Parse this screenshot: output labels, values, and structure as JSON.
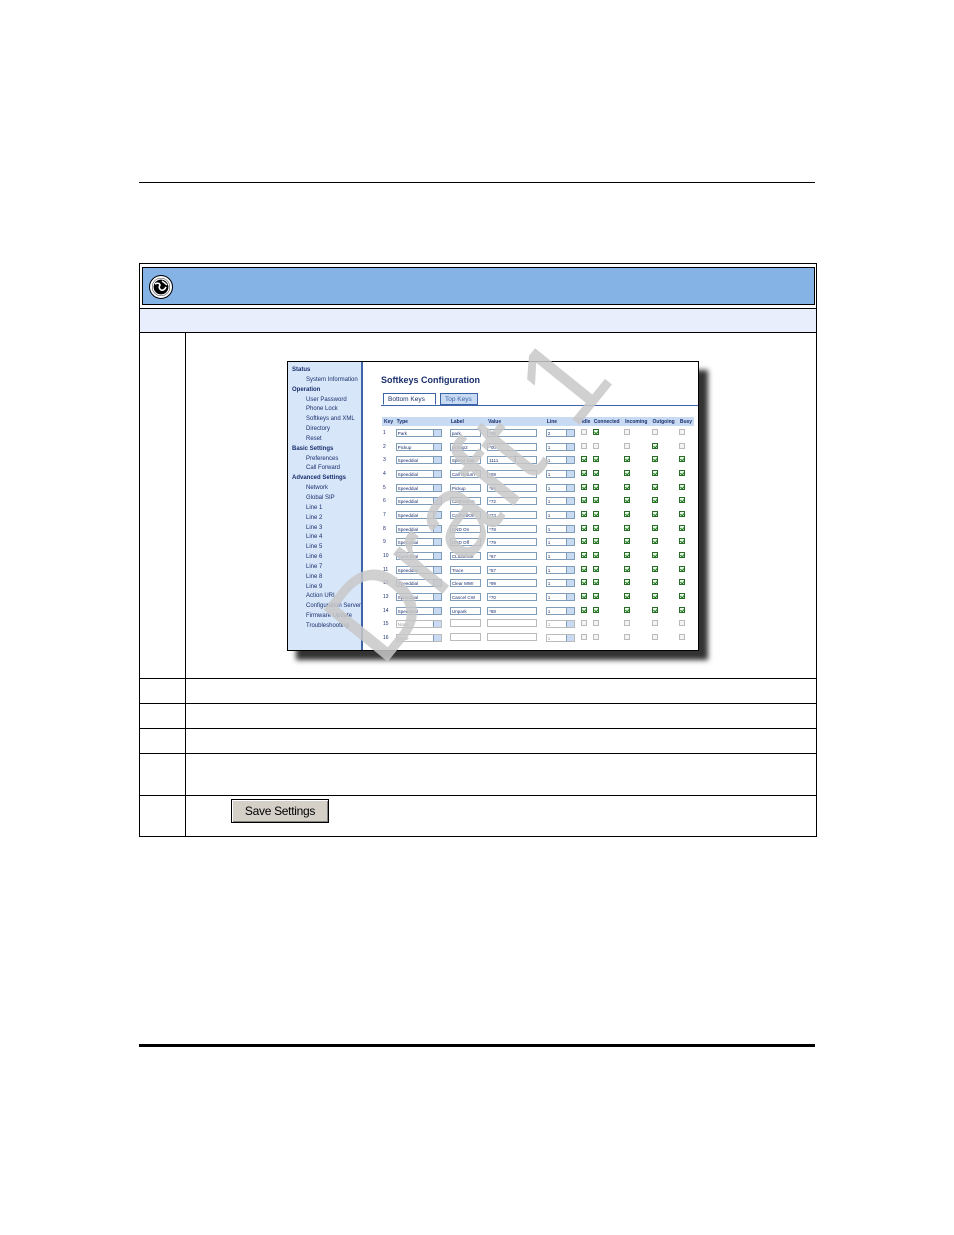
{
  "nav": {
    "items": [
      {
        "label": "Status",
        "kind": "sec"
      },
      {
        "label": "System Information",
        "kind": "sub"
      },
      {
        "label": "Operation",
        "kind": "sec"
      },
      {
        "label": "User Password",
        "kind": "sub"
      },
      {
        "label": "Phone Lock",
        "kind": "sub"
      },
      {
        "label": "Softkeys and XML",
        "kind": "sub"
      },
      {
        "label": "Directory",
        "kind": "sub"
      },
      {
        "label": "Reset",
        "kind": "sub"
      },
      {
        "label": "Basic Settings",
        "kind": "sec"
      },
      {
        "label": "Preferences",
        "kind": "sub"
      },
      {
        "label": "Call Forward",
        "kind": "sub"
      },
      {
        "label": "Advanced Settings",
        "kind": "sec"
      },
      {
        "label": "Network",
        "kind": "sub"
      },
      {
        "label": "Global SIP",
        "kind": "sub"
      },
      {
        "label": "Line 1",
        "kind": "sub"
      },
      {
        "label": "Line 2",
        "kind": "sub"
      },
      {
        "label": "Line 3",
        "kind": "sub"
      },
      {
        "label": "Line 4",
        "kind": "sub"
      },
      {
        "label": "Line 5",
        "kind": "sub"
      },
      {
        "label": "Line 6",
        "kind": "sub"
      },
      {
        "label": "Line 7",
        "kind": "sub"
      },
      {
        "label": "Line 8",
        "kind": "sub"
      },
      {
        "label": "Line 9",
        "kind": "sub"
      },
      {
        "label": "Action URI",
        "kind": "sub"
      },
      {
        "label": "Configuration Server",
        "kind": "sub"
      },
      {
        "label": "Firmware Update",
        "kind": "sub"
      },
      {
        "label": "Troubleshooting",
        "kind": "sub"
      }
    ]
  },
  "config": {
    "title": "Softkeys Configuration",
    "tabs": [
      "Bottom Keys",
      "Top Keys"
    ],
    "columns": [
      "Key",
      "Type",
      "Label",
      "Value",
      "Line",
      "Idle",
      "Connected",
      "Incoming",
      "Outgoing",
      "Busy"
    ],
    "rows": [
      {
        "key": "1",
        "type": "Park",
        "label": "park",
        "value": "*00",
        "line": "2",
        "idle": false,
        "connected": true,
        "incoming": false,
        "outgoing": false,
        "busy": false,
        "enabled": true
      },
      {
        "key": "2",
        "type": "Pickup",
        "label": "pickup2",
        "value": "*00",
        "line": "1",
        "idle": false,
        "connected": false,
        "incoming": false,
        "outgoing": true,
        "busy": false,
        "enabled": true
      },
      {
        "key": "3",
        "type": "Speeddial",
        "label": "Speed Dial",
        "value": "1111",
        "line": "1",
        "idle": true,
        "connected": true,
        "incoming": true,
        "outgoing": true,
        "busy": true,
        "enabled": true
      },
      {
        "key": "4",
        "type": "Speeddial",
        "label": "Call Return",
        "value": "*69",
        "line": "1",
        "idle": true,
        "connected": true,
        "incoming": true,
        "outgoing": true,
        "busy": true,
        "enabled": true
      },
      {
        "key": "5",
        "type": "Speeddial",
        "label": "Pickup",
        "value": "*98",
        "line": "1",
        "idle": true,
        "connected": true,
        "incoming": true,
        "outgoing": true,
        "busy": true,
        "enabled": true
      },
      {
        "key": "6",
        "type": "Speeddial",
        "label": "CallFwdOn",
        "value": "*72",
        "line": "1",
        "idle": true,
        "connected": true,
        "incoming": true,
        "outgoing": true,
        "busy": true,
        "enabled": true
      },
      {
        "key": "7",
        "type": "Speeddial",
        "label": "CallFwdOff",
        "value": "*73",
        "line": "1",
        "idle": true,
        "connected": true,
        "incoming": true,
        "outgoing": true,
        "busy": true,
        "enabled": true
      },
      {
        "key": "8",
        "type": "Speeddial",
        "label": "DND On",
        "value": "*78",
        "line": "1",
        "idle": true,
        "connected": true,
        "incoming": true,
        "outgoing": true,
        "busy": true,
        "enabled": true
      },
      {
        "key": "9",
        "type": "Speeddial",
        "label": "DND Off",
        "value": "*79",
        "line": "1",
        "idle": true,
        "connected": true,
        "incoming": true,
        "outgoing": true,
        "busy": true,
        "enabled": true
      },
      {
        "key": "10",
        "type": "Speeddial",
        "label": "CLIDBlock",
        "value": "*67",
        "line": "1",
        "idle": true,
        "connected": true,
        "incoming": true,
        "outgoing": true,
        "busy": true,
        "enabled": true
      },
      {
        "key": "11",
        "type": "Speeddial",
        "label": "Trace",
        "value": "*57",
        "line": "1",
        "idle": true,
        "connected": true,
        "incoming": true,
        "outgoing": true,
        "busy": true,
        "enabled": true
      },
      {
        "key": "12",
        "type": "Speeddial",
        "label": "Clear MWI",
        "value": "*99",
        "line": "1",
        "idle": true,
        "connected": true,
        "incoming": true,
        "outgoing": true,
        "busy": true,
        "enabled": true
      },
      {
        "key": "13",
        "type": "Speeddial",
        "label": "Cancel CW",
        "value": "*70",
        "line": "1",
        "idle": true,
        "connected": true,
        "incoming": true,
        "outgoing": true,
        "busy": true,
        "enabled": true
      },
      {
        "key": "14",
        "type": "Speeddial",
        "label": "Unpark",
        "value": "*88",
        "line": "1",
        "idle": true,
        "connected": true,
        "incoming": true,
        "outgoing": true,
        "busy": true,
        "enabled": true
      },
      {
        "key": "15",
        "type": "None",
        "label": "",
        "value": "",
        "line": "1",
        "idle": false,
        "connected": false,
        "incoming": false,
        "outgoing": false,
        "busy": false,
        "enabled": false
      },
      {
        "key": "16",
        "type": "None",
        "label": "",
        "value": "",
        "line": "1",
        "idle": false,
        "connected": false,
        "incoming": false,
        "outgoing": false,
        "busy": false,
        "enabled": false
      }
    ]
  },
  "save_button": {
    "label": "Save Settings"
  },
  "watermark": "Draft 1"
}
